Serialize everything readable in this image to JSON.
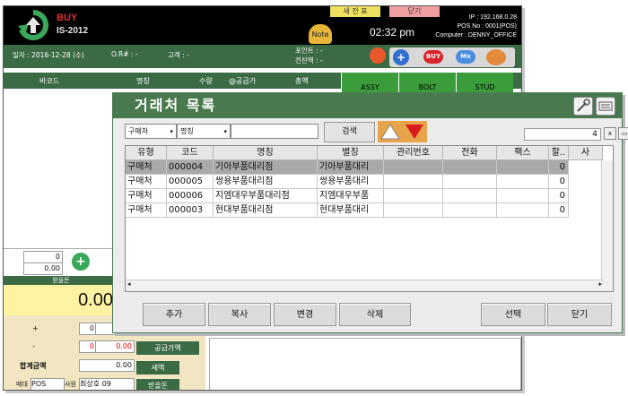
{
  "pos": {
    "brand_line1": "BUY",
    "brand_line2": "IS-2012",
    "tab_new": "새 전 표",
    "tab_close": "닫기",
    "clock": "02:32 pm",
    "ip": "IP : 192.168.0.28",
    "pos_no": "POS No : 0001(POS)",
    "computer": "Computer : DENNY_OFFICE",
    "note_icon_label": "Note",
    "info": {
      "date": "일자 : 2016-12-28 (수)",
      "order_no": "O.R# : -",
      "customer": "고객 : -",
      "points": "포인트 : -",
      "prev_balance": "전잔액 : -"
    },
    "header_buttons": {
      "buy": "BUY",
      "mx": "Mx"
    },
    "columns": [
      "바코드",
      "명칭",
      "수량",
      "@공급가",
      "총액"
    ],
    "category_tabs": [
      "ASSY",
      "BOLT",
      "STUD"
    ],
    "qty_values": [
      "0",
      "0.00"
    ],
    "paid_label": "받을돈",
    "paid_amount": "0.00",
    "calc": {
      "plus_label": "+",
      "plus_values": [
        "0",
        "0"
      ],
      "minus_label": "-",
      "minus_values": [
        "0",
        "0.00"
      ],
      "total_label": "합계금액",
      "total_value": "0.00",
      "sale_label": "매대",
      "sale_value": "POS",
      "staff_label": "사원",
      "staff_value": "최상호 09",
      "supply_label": "공급가액",
      "tax_label": "세액",
      "receive_label": "받을돈"
    }
  },
  "dialog": {
    "title": "거래처 목록",
    "filter_type": "구매처",
    "filter_field": "명칭",
    "keyword": "",
    "search_button": "검색",
    "count": "4",
    "columns": [
      "유형",
      "코드",
      "명칭",
      "별칭",
      "관리번호",
      "전화",
      "팩스",
      "할..",
      "사"
    ],
    "rows": [
      [
        "구매처",
        "000004",
        "기아부품대리점",
        "기아부품대리",
        "",
        "",
        "",
        "0"
      ],
      [
        "구매처",
        "000005",
        "쌍용부품대리점",
        "쌍용부품대리",
        "",
        "",
        "",
        "0"
      ],
      [
        "구매처",
        "000006",
        "지엠대우부품대리점",
        "지엠대우부품",
        "",
        "",
        "",
        "0"
      ],
      [
        "구매처",
        "000003",
        "현대부품대리점",
        "현대부품대리",
        "",
        "",
        "",
        "0"
      ]
    ],
    "selected_row": 0,
    "buttons": {
      "add": "추가",
      "copy": "복사",
      "edit": "변경",
      "delete": "삭제",
      "select": "선택",
      "close": "닫기"
    }
  },
  "colors": {
    "title_green": "#497a4f",
    "selected_row": "#a9a9a9",
    "pos_green": "#3b6b45",
    "brand_red": "#e03030"
  }
}
